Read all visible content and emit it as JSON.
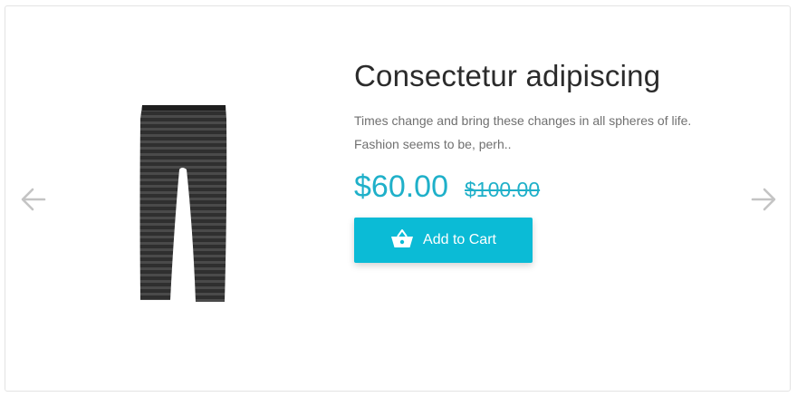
{
  "product": {
    "title": "Consectetur adipiscing",
    "description": "Times change and bring these changes in all spheres of life. Fashion seems to be, perh..",
    "price": "$60.00",
    "old_price": "$100.00",
    "image_icon": "striped-leggings-image"
  },
  "actions": {
    "add_to_cart_label": "Add to Cart",
    "add_to_cart_icon": "basket-icon"
  },
  "navigation": {
    "prev_icon": "arrow-left-icon",
    "next_icon": "arrow-right-icon"
  },
  "colors": {
    "accent": "#1fb0c9",
    "button": "#0bbbd6",
    "title": "#2b2b2b",
    "text": "#707070",
    "arrow": "#bdbdbd"
  }
}
